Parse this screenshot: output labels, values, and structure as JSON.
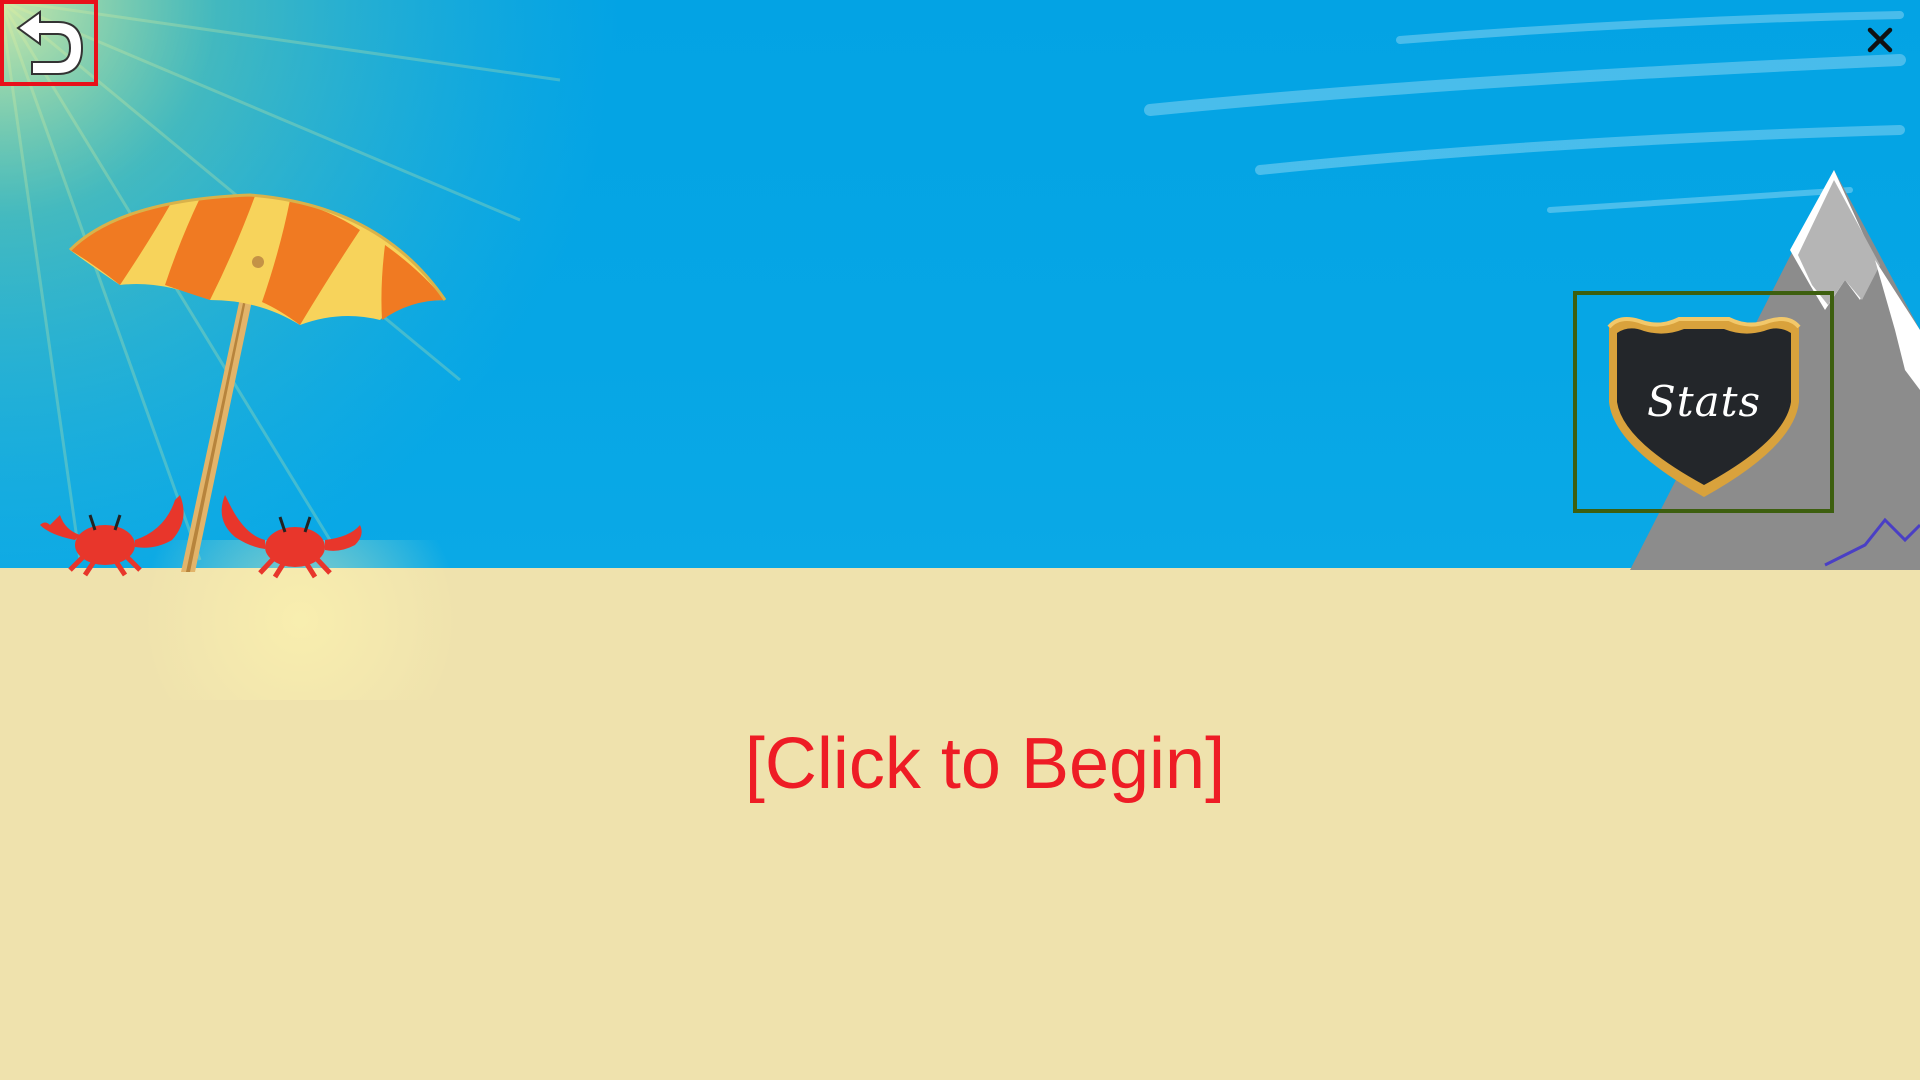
{
  "game": {
    "begin_prompt": "[Click to Begin]",
    "stats_label": "Stats"
  },
  "icons": {
    "back": "back-arrow-icon",
    "close": "close-icon"
  },
  "colors": {
    "sky": "#03a3e4",
    "sand": "#efe2ad",
    "prompt_text": "#ee1c25",
    "back_highlight": "#e8101a",
    "stats_highlight": "#3d5f0f",
    "shield_body": "#23262a",
    "shield_rim": "#d9a23c"
  }
}
